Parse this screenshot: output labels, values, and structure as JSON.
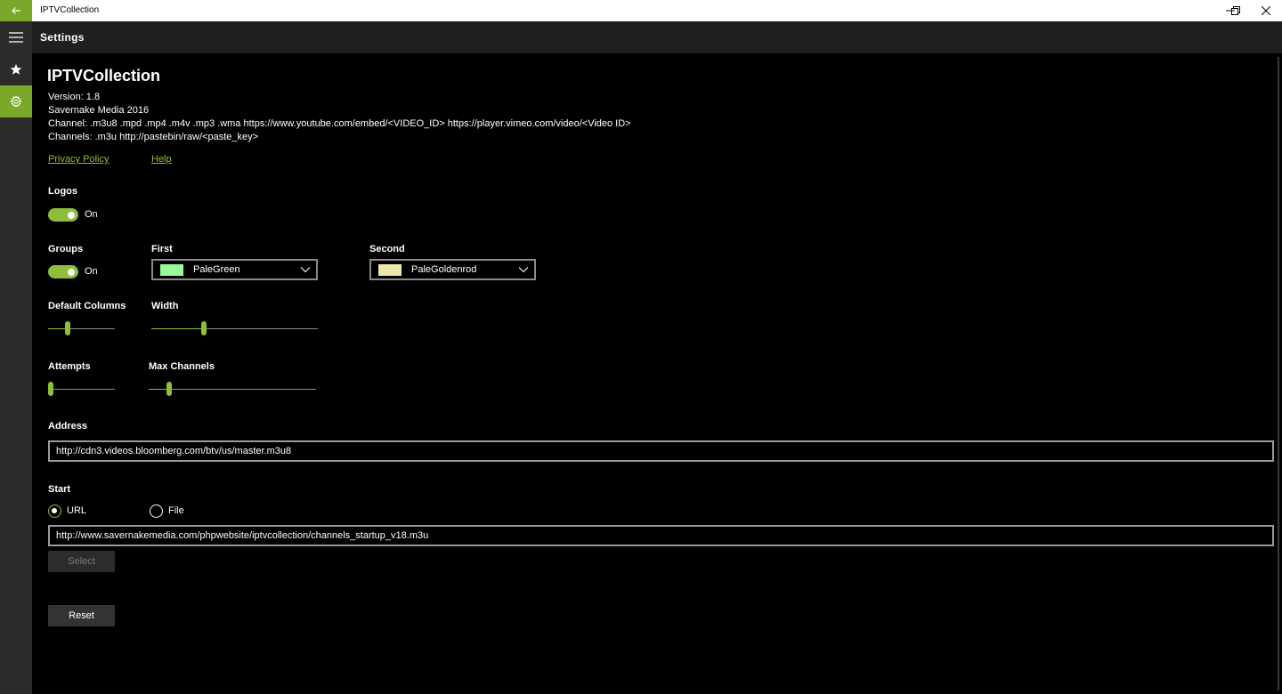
{
  "window": {
    "title": "IPTVCollection",
    "accent": "#7aa82a"
  },
  "header": {
    "title": "Settings"
  },
  "rail": {
    "items": [
      {
        "icon": "hamburger-menu-icon"
      },
      {
        "icon": "star-icon"
      },
      {
        "icon": "gear-icon",
        "active": true
      }
    ]
  },
  "about": {
    "title": "IPTVCollection",
    "version": "Version: 1.8",
    "copyright": "Savernake Media 2016",
    "channel_formats": "Channel: .m3u8 .mpd .mp4 .m4v .mp3 .wma https://www.youtube.com/embed/<VIDEO_ID> https://player.vimeo.com/video/<Video ID>",
    "channels_formats": "Channels: .m3u http://pastebin/raw/<paste_key>",
    "privacy_link": "Privacy Policy",
    "help_link": "Help"
  },
  "logos": {
    "label": "Logos",
    "state": "On"
  },
  "groups": {
    "label": "Groups",
    "state": "On",
    "first": {
      "label": "First",
      "value": "PaleGreen",
      "color": "#98fb98"
    },
    "second": {
      "label": "Second",
      "value": "PaleGoldenrod",
      "color": "#eee8aa"
    }
  },
  "sliders": {
    "default_columns": {
      "label": "Default Columns",
      "fraction": 0.27
    },
    "width": {
      "label": "Width",
      "fraction": 0.31
    },
    "attempts": {
      "label": "Attempts",
      "fraction": 0.0
    },
    "max_channels": {
      "label": "Max Channels",
      "fraction": 0.11
    }
  },
  "address": {
    "label": "Address",
    "value": "http://cdn3.videos.bloomberg.com/btv/us/master.m3u8"
  },
  "start": {
    "label": "Start",
    "url_option": "URL",
    "file_option": "File",
    "selected": "URL",
    "value": "http://www.savernakemedia.com/phpwebsite/iptvcollection/channels_startup_v18.m3u"
  },
  "buttons": {
    "select": "Select",
    "reset": "Reset"
  }
}
